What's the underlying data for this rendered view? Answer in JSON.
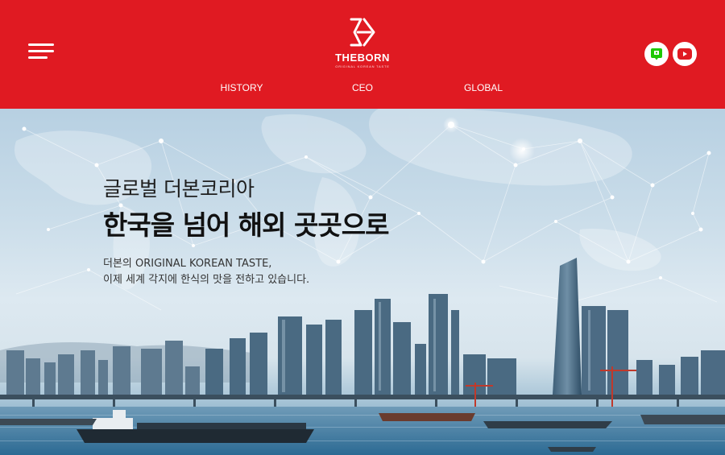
{
  "brand": {
    "name": "THEBORN",
    "tagline": "ORIGINAL KOREAN TASTE",
    "primary_color": "#e01a22"
  },
  "header": {
    "menu_icon": "hamburger-menu-icon",
    "social": [
      {
        "name": "naver-blog",
        "icon": "blog-icon",
        "color": "#1ec800"
      },
      {
        "name": "youtube",
        "icon": "youtube-icon",
        "color": "#e01a22"
      }
    ]
  },
  "nav": {
    "items": [
      {
        "label": "HISTORY"
      },
      {
        "label": "CEO"
      },
      {
        "label": "GLOBAL"
      }
    ]
  },
  "hero": {
    "subtitle": "글로벌 더본코리아",
    "title": "한국을 넘어 해외 곳곳으로",
    "desc_line1": "더본의 ORIGINAL KOREAN TASTE,",
    "desc_line2": "이제 세계 각지에 한식의 맛을 전하고 있습니다."
  }
}
